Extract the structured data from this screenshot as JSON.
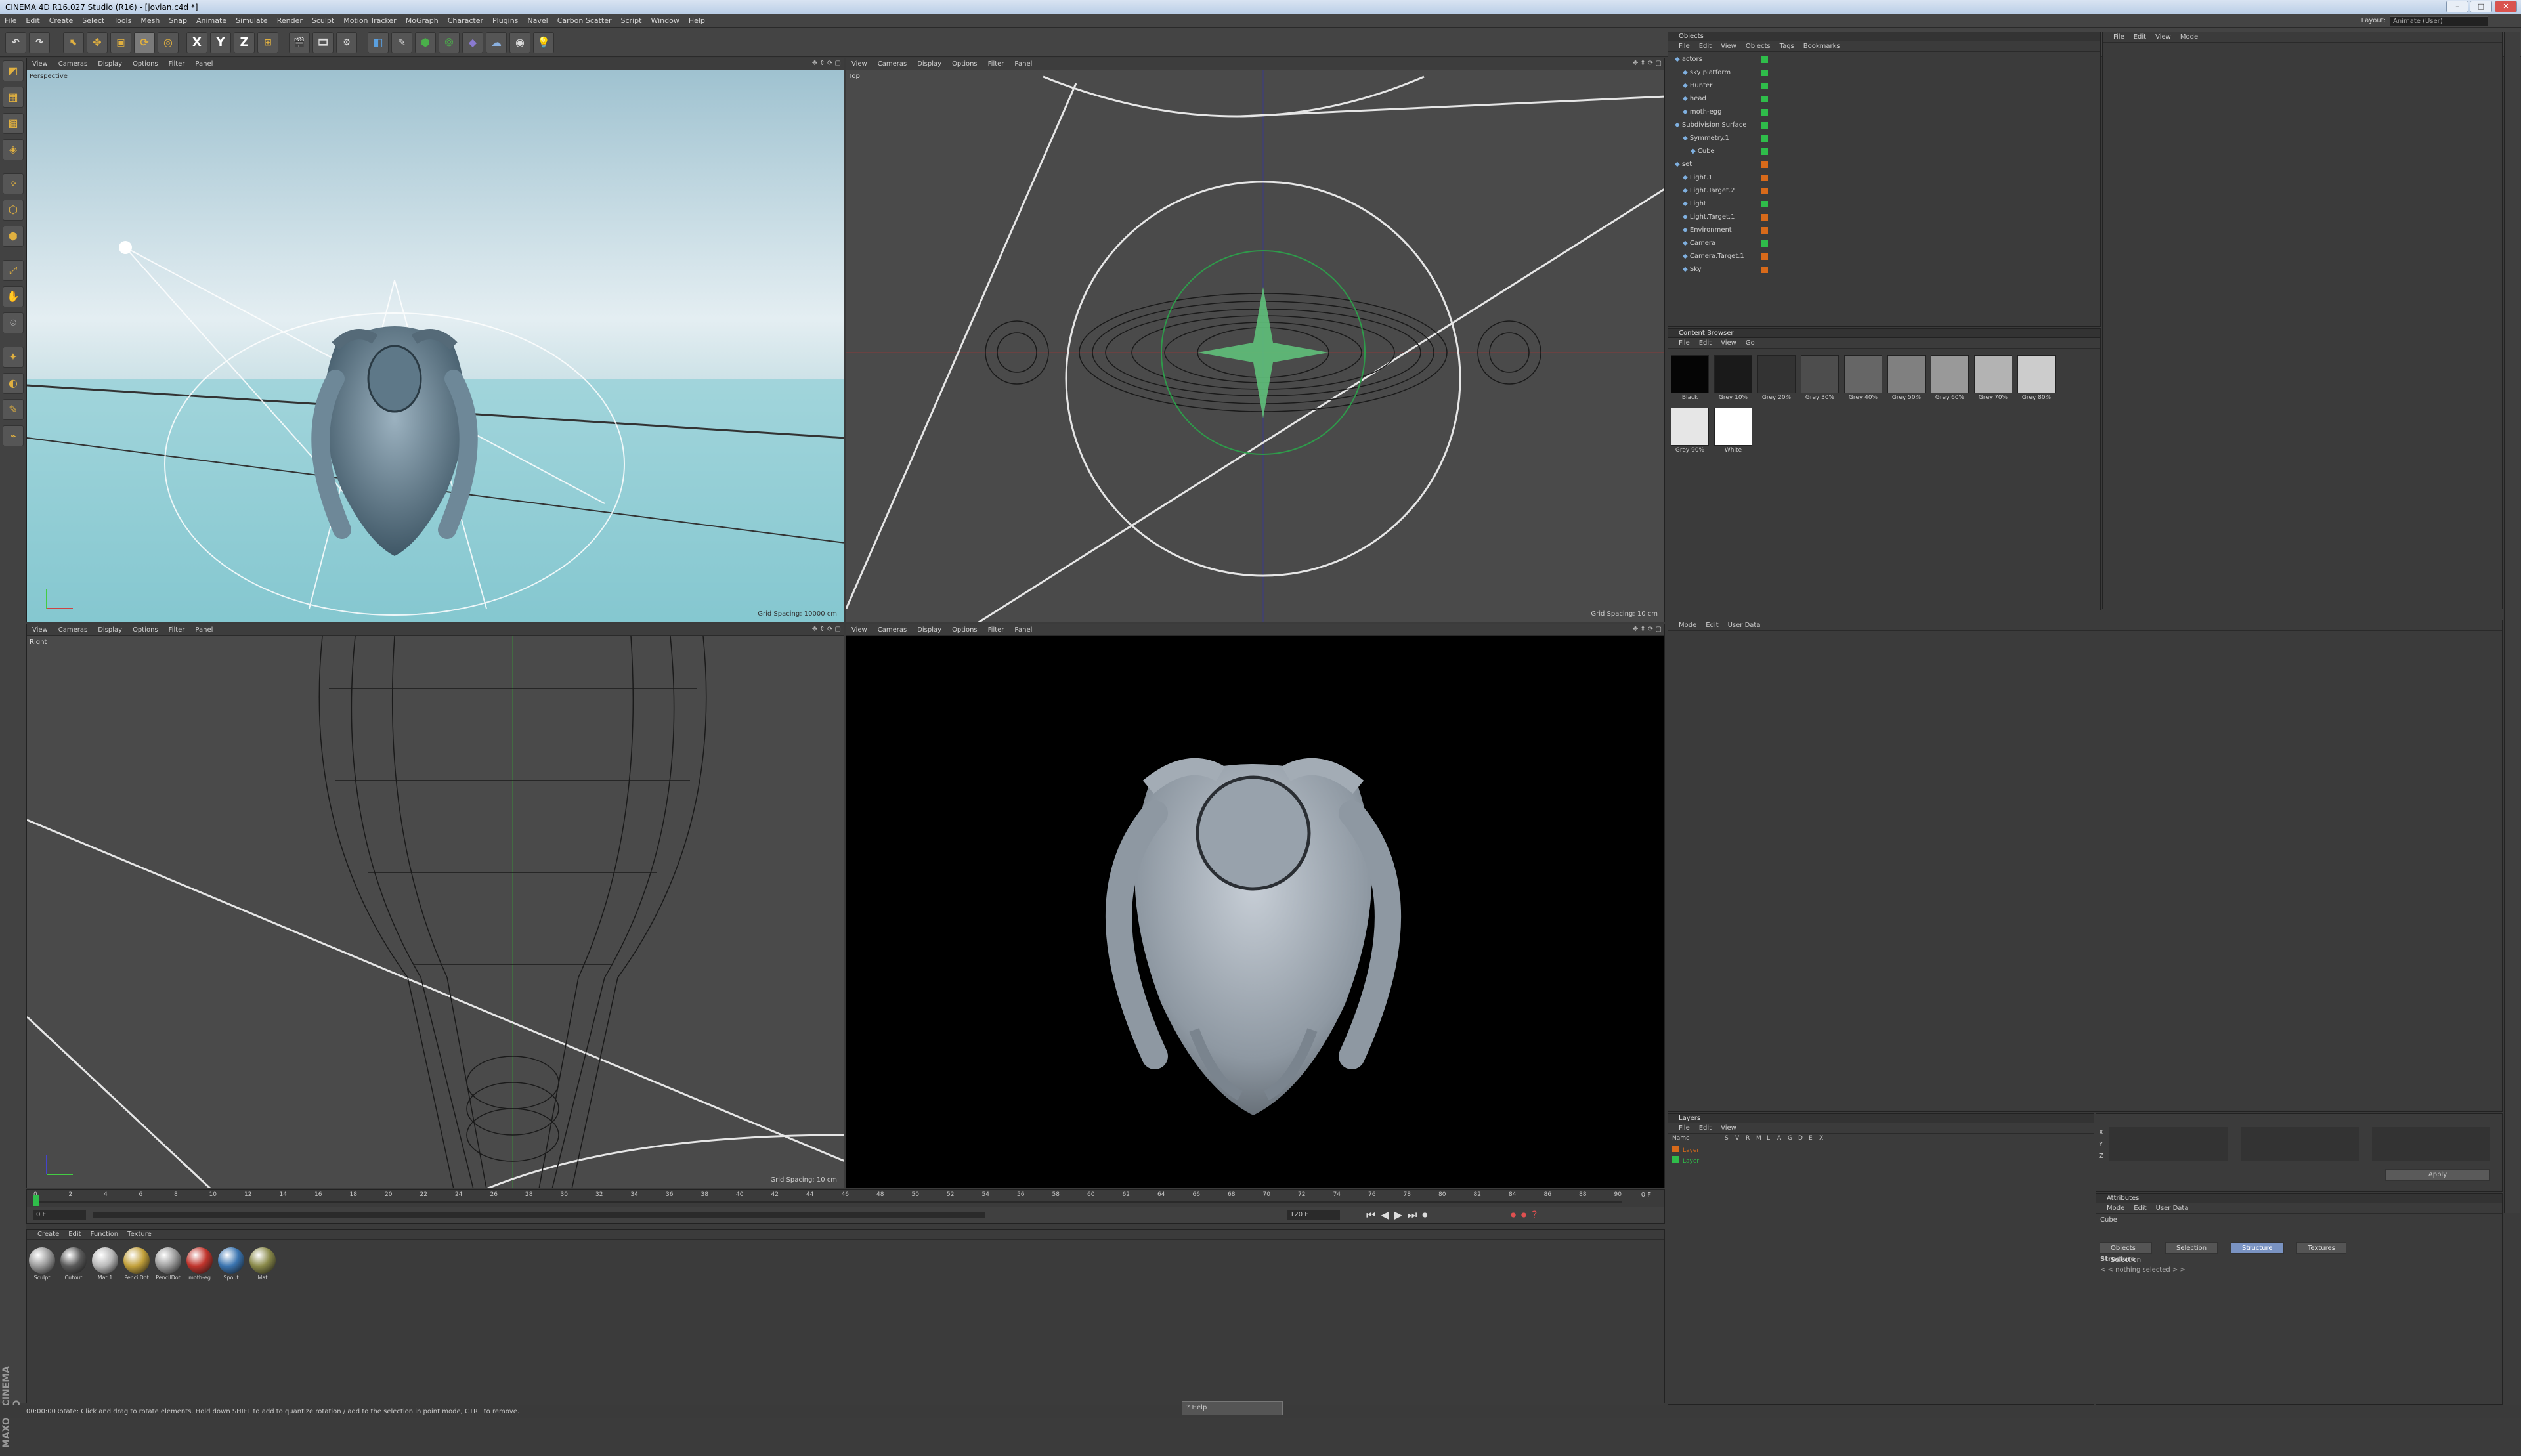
{
  "window": {
    "title": "CINEMA 4D R16.027 Studio (R16) - [jovian.c4d *]"
  },
  "menus": [
    "File",
    "Edit",
    "Create",
    "Select",
    "Tools",
    "Mesh",
    "Snap",
    "Animate",
    "Simulate",
    "Render",
    "Sculpt",
    "Motion Tracker",
    "MoGraph",
    "Character",
    "Plugins",
    "Navel",
    "Carbon Scatter",
    "Script",
    "Window",
    "Help"
  ],
  "layout": {
    "label": "Layout:",
    "value": "Animate (User)"
  },
  "toolbar_icons": [
    "undo-icon",
    "redo-icon",
    "live-select-icon",
    "move-icon",
    "scale-icon",
    "rotate-icon",
    "last-tool-icon",
    "x-axis-icon",
    "y-axis-icon",
    "z-axis-icon",
    "coordinate-system-icon",
    "render-view-icon",
    "render-picture-viewer-icon",
    "render-settings-icon",
    "cube-icon",
    "pen-icon",
    "subdivision-icon",
    "array-icon",
    "deformer-icon",
    "scene-icon",
    "camera-icon",
    "light-icon"
  ],
  "toolbar_glyphs": {
    "x": "X",
    "y": "Y",
    "z": "Z"
  },
  "viewports": {
    "menu": [
      "View",
      "Cameras",
      "Display",
      "Options",
      "Filter",
      "Panel"
    ],
    "top_left": {
      "label": "Perspective",
      "grid": "Grid Spacing: 10000 cm"
    },
    "top_right": {
      "label": "Top",
      "grid": "Grid Spacing: 10 cm"
    },
    "bottom_left": {
      "label": "Right",
      "grid": "Grid Spacing: 10 cm"
    },
    "bottom_right": {
      "label": ""
    }
  },
  "objects_panel": {
    "title": "Objects",
    "menu": [
      "File",
      "Edit",
      "View",
      "Objects",
      "Tags",
      "Bookmarks"
    ],
    "items": [
      "actors",
      "sky platform",
      "Hunter",
      "head",
      "moth-egg",
      "Subdivision Surface",
      "Symmetry.1",
      "Cube",
      "set",
      "Light.1",
      "Light.Target.2",
      "Light",
      "Light.Target.1",
      "Environment",
      "Camera",
      "Camera.Target.1",
      "Sky"
    ]
  },
  "content_browser": {
    "title": "Content Browser",
    "menu": [
      "File",
      "Edit",
      "View",
      "Go"
    ],
    "swatches": [
      {
        "label": "Black",
        "color": "#050505"
      },
      {
        "label": "Grey 10%",
        "color": "#1a1a1a"
      },
      {
        "label": "Grey 20%",
        "color": "#333333"
      },
      {
        "label": "Grey 30%",
        "color": "#4d4d4d"
      },
      {
        "label": "Grey 40%",
        "color": "#666666"
      },
      {
        "label": "Grey 50%",
        "color": "#808080"
      },
      {
        "label": "Grey 60%",
        "color": "#999999"
      },
      {
        "label": "Grey 70%",
        "color": "#b3b3b3"
      },
      {
        "label": "Grey 80%",
        "color": "#cccccc"
      },
      {
        "label": "Grey 90%",
        "color": "#e6e6e6"
      },
      {
        "label": "White",
        "color": "#ffffff"
      }
    ]
  },
  "right_panel": {
    "menu": [
      "File",
      "Edit",
      "View",
      "Mode"
    ]
  },
  "attr_top": {
    "menu": [
      "Mode",
      "Edit",
      "User Data"
    ]
  },
  "layers_panel": {
    "title": "Layers",
    "menu": [
      "File",
      "Edit",
      "View"
    ],
    "columns": [
      "Name",
      "S",
      "V",
      "R",
      "M",
      "L",
      "A",
      "G",
      "D",
      "E",
      "X"
    ],
    "rows": [
      "Layer",
      "Layer"
    ]
  },
  "attributes": {
    "title": "Attributes",
    "menu": [
      "Mode",
      "Edit",
      "User Data"
    ],
    "object": "Cube",
    "tabs": [
      "Objects Selection",
      "Selection",
      "Structure",
      "Textures"
    ],
    "active_tab": "Structure",
    "section": "Structure",
    "note": "< < nothing selected > >"
  },
  "coords": {
    "apply": "Apply"
  },
  "timeline": {
    "ticks": [
      "0",
      "2",
      "4",
      "6",
      "8",
      "10",
      "12",
      "14",
      "16",
      "18",
      "20",
      "22",
      "24",
      "26",
      "28",
      "30",
      "32",
      "34",
      "36",
      "38",
      "40",
      "42",
      "44",
      "46",
      "48",
      "50",
      "52",
      "54",
      "56",
      "58",
      "60",
      "62",
      "64",
      "66",
      "68",
      "70",
      "72",
      "74",
      "76",
      "78",
      "80",
      "82",
      "84",
      "86",
      "88",
      "90"
    ],
    "current_frame": "0 F",
    "end_frame": "120 F"
  },
  "material_manager": {
    "menu": [
      "Create",
      "Edit",
      "Function",
      "Texture"
    ],
    "materials": [
      {
        "label": "Sculpt",
        "color": "#9a9a9a"
      },
      {
        "label": "Cutout",
        "color": "#5a5a5a"
      },
      {
        "label": "Mat.1",
        "color": "#b8b8b8"
      },
      {
        "label": "PencilDot",
        "color": "#c2a03a"
      },
      {
        "label": "PencilDot",
        "color": "#9c9c9c"
      },
      {
        "label": "moth-eg",
        "color": "#c0342c"
      },
      {
        "label": "Spout",
        "color": "#3a74b0"
      },
      {
        "label": "Mat",
        "color": "#8a8a4a"
      }
    ]
  },
  "status": {
    "time": "00:00:00",
    "message": "Rotate: Click and drag to rotate elements. Hold down SHIFT to add to quantize rotation / add to the selection in point mode, CTRL to remove."
  },
  "help_button": {
    "label": "Help"
  },
  "brand": {
    "logo": "MAXON CINEMA 4D"
  }
}
